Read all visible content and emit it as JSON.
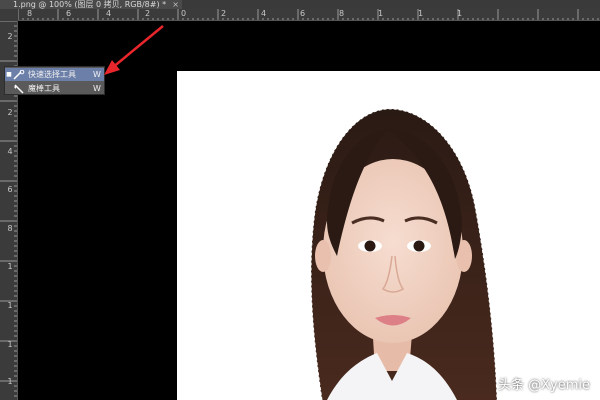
{
  "document": {
    "tab_title": "1.png @ 100% (图层 0 拷贝, RGB/8#) *",
    "close_label": "×"
  },
  "ruler": {
    "top_labels": [
      "8",
      "6",
      "4",
      "2",
      "0",
      "2",
      "4",
      "6",
      "8",
      "1",
      "1",
      "1"
    ],
    "left_labels": [
      "2",
      "2",
      "4",
      "6",
      "8",
      "1",
      "1",
      "1",
      "1"
    ]
  },
  "tool_flyout": {
    "items": [
      {
        "label": "快速选择工具",
        "shortcut": "W",
        "icon": "quick-selection-icon",
        "selected": true
      },
      {
        "label": "魔棒工具",
        "shortcut": "W",
        "icon": "magic-wand-icon",
        "selected": false
      }
    ],
    "highlight_color": "#6b7fa8"
  },
  "watermark": {
    "text": "头条 @Xyemie"
  },
  "annotation": {
    "arrow_color": "#e8262c"
  }
}
